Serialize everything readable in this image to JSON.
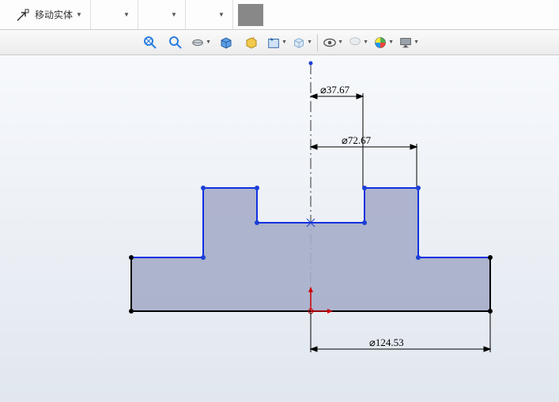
{
  "toolbar": {
    "move_entity_label": "移动实体"
  },
  "dimensions": {
    "d1": "⌀37.67",
    "d2": "⌀72.67",
    "d3": "⌀124.53"
  },
  "icons": {
    "move": "move-entity-icon",
    "zoom_fit": "zoom-fit-icon",
    "zoom_window": "zoom-window-icon",
    "section": "section-view-icon",
    "isometric": "isometric-icon",
    "display_style": "display-style-icon",
    "orientation": "orientation-icon",
    "cube": "view-cube-icon",
    "visibility": "visibility-icon",
    "filter": "filter-icon",
    "appearance": "appearance-icon",
    "monitor": "monitor-icon"
  }
}
